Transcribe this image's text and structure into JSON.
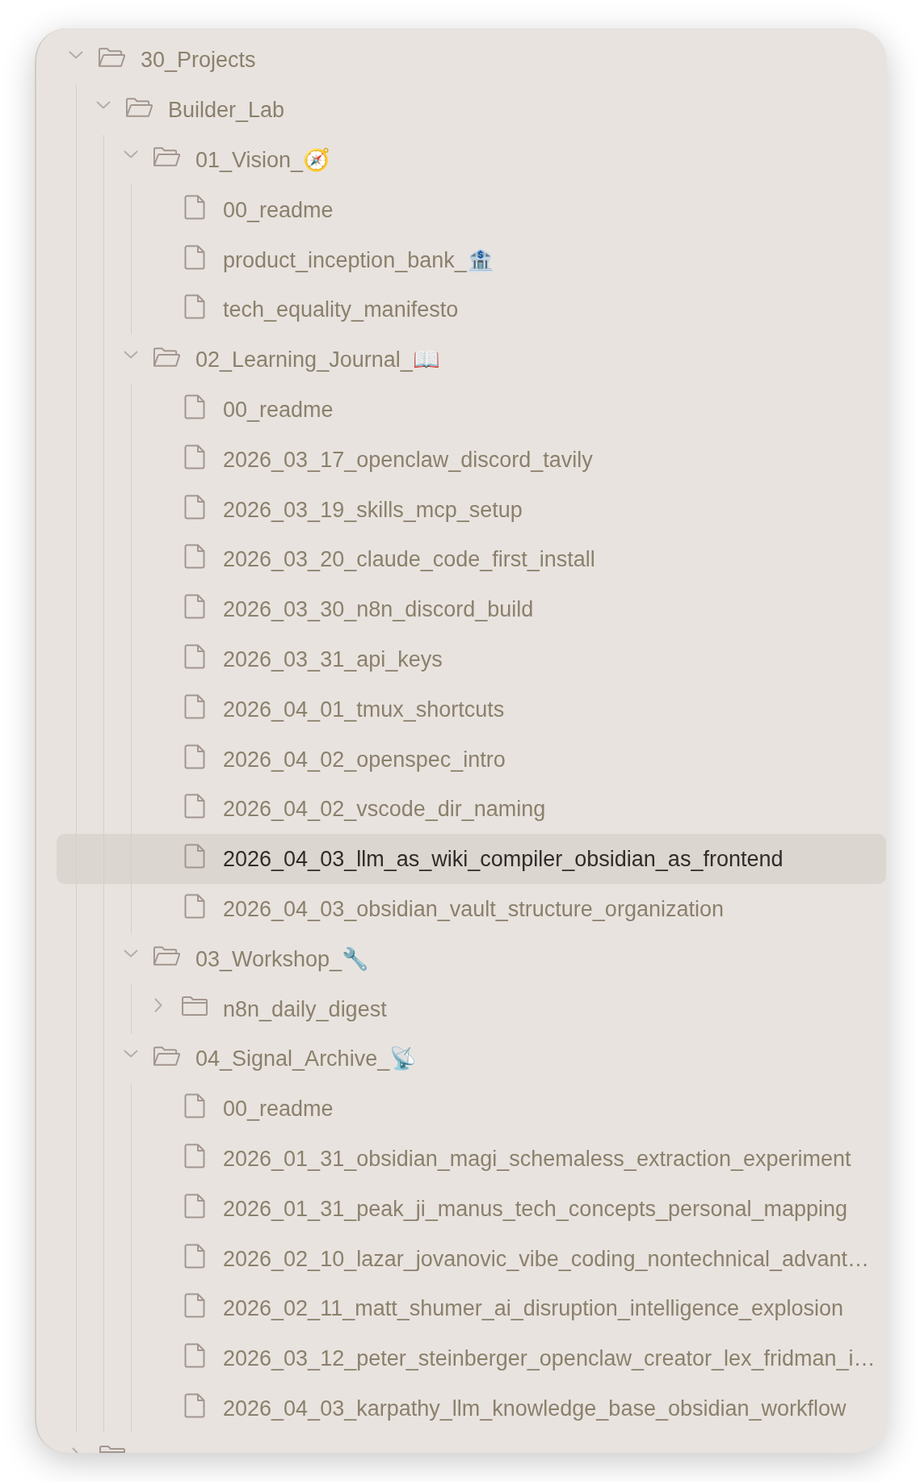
{
  "tree": [
    {
      "kind": "folder",
      "label": "30_Projects",
      "expanded": true,
      "selected": false,
      "children": [
        {
          "kind": "folder",
          "label": "Builder_Lab",
          "expanded": true,
          "selected": false,
          "children": [
            {
              "kind": "folder",
              "label": "01_Vision_🧭",
              "expanded": true,
              "selected": false,
              "children": [
                {
                  "kind": "file",
                  "label": "00_readme",
                  "selected": false
                },
                {
                  "kind": "file",
                  "label": "product_inception_bank_🏦",
                  "selected": false
                },
                {
                  "kind": "file",
                  "label": "tech_equality_manifesto",
                  "selected": false
                }
              ]
            },
            {
              "kind": "folder",
              "label": "02_Learning_Journal_📖",
              "expanded": true,
              "selected": false,
              "children": [
                {
                  "kind": "file",
                  "label": "00_readme",
                  "selected": false
                },
                {
                  "kind": "file",
                  "label": "2026_03_17_openclaw_discord_tavily",
                  "selected": false
                },
                {
                  "kind": "file",
                  "label": "2026_03_19_skills_mcp_setup",
                  "selected": false
                },
                {
                  "kind": "file",
                  "label": "2026_03_20_claude_code_first_install",
                  "selected": false
                },
                {
                  "kind": "file",
                  "label": "2026_03_30_n8n_discord_build",
                  "selected": false
                },
                {
                  "kind": "file",
                  "label": "2026_03_31_api_keys",
                  "selected": false
                },
                {
                  "kind": "file",
                  "label": "2026_04_01_tmux_shortcuts",
                  "selected": false
                },
                {
                  "kind": "file",
                  "label": "2026_04_02_openspec_intro",
                  "selected": false
                },
                {
                  "kind": "file",
                  "label": "2026_04_02_vscode_dir_naming",
                  "selected": false
                },
                {
                  "kind": "file",
                  "label": "2026_04_03_llm_as_wiki_compiler_obsidian_as_frontend",
                  "selected": true
                },
                {
                  "kind": "file",
                  "label": "2026_04_03_obsidian_vault_structure_organization",
                  "selected": false
                }
              ]
            },
            {
              "kind": "folder",
              "label": "03_Workshop_🔧",
              "expanded": true,
              "selected": false,
              "children": [
                {
                  "kind": "folder",
                  "label": "n8n_daily_digest",
                  "expanded": false,
                  "selected": false
                }
              ]
            },
            {
              "kind": "folder",
              "label": "04_Signal_Archive_📡",
              "expanded": true,
              "selected": false,
              "children": [
                {
                  "kind": "file",
                  "label": "00_readme",
                  "selected": false
                },
                {
                  "kind": "file",
                  "label": "2026_01_31_obsidian_magi_schemaless_extraction_experiment",
                  "selected": false
                },
                {
                  "kind": "file",
                  "label": "2026_01_31_peak_ji_manus_tech_concepts_personal_mapping",
                  "selected": false
                },
                {
                  "kind": "file",
                  "label": "2026_02_10_lazar_jovanovic_vibe_coding_nontechnical_advant…",
                  "selected": false
                },
                {
                  "kind": "file",
                  "label": "2026_02_11_matt_shumer_ai_disruption_intelligence_explosion",
                  "selected": false
                },
                {
                  "kind": "file",
                  "label": "2026_03_12_peter_steinberger_openclaw_creator_lex_fridman_i…",
                  "selected": false
                },
                {
                  "kind": "file",
                  "label": "2026_04_03_karpathy_llm_knowledge_base_obsidian_workflow",
                  "selected": false
                }
              ]
            }
          ]
        }
      ]
    },
    {
      "kind": "folder",
      "expanded": false,
      "selected": false
    }
  ]
}
